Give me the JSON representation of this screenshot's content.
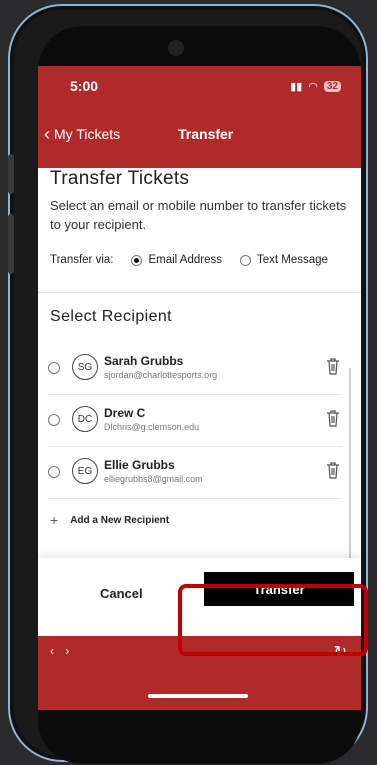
{
  "status": {
    "time": "5:00",
    "battery": "32"
  },
  "nav": {
    "back_label": "My Tickets",
    "title": "Transfer"
  },
  "page": {
    "title": "Transfer Tickets",
    "description": "Select an email or mobile number to transfer tickets to your recipient.",
    "via_label": "Transfer via:",
    "via_options": [
      "Email Address",
      "Text Message"
    ],
    "via_selected": "Email Address",
    "recipients_title": "Select Recipient",
    "recipients": [
      {
        "initials": "SG",
        "name": "Sarah Grubbs",
        "email": "sjordan@charlottesports.org"
      },
      {
        "initials": "DC",
        "name": "Drew C",
        "email": "Dlchris@g.clemson.edu"
      },
      {
        "initials": "EG",
        "name": "Ellie Grubbs",
        "email": "elliegrubbs8@gmail.com"
      }
    ],
    "add_label": "Add a New Recipient"
  },
  "actions": {
    "cancel": "Cancel",
    "transfer": "Transfer"
  },
  "colors": {
    "brand_red": "#b02a2a",
    "highlight": "#c00000"
  }
}
